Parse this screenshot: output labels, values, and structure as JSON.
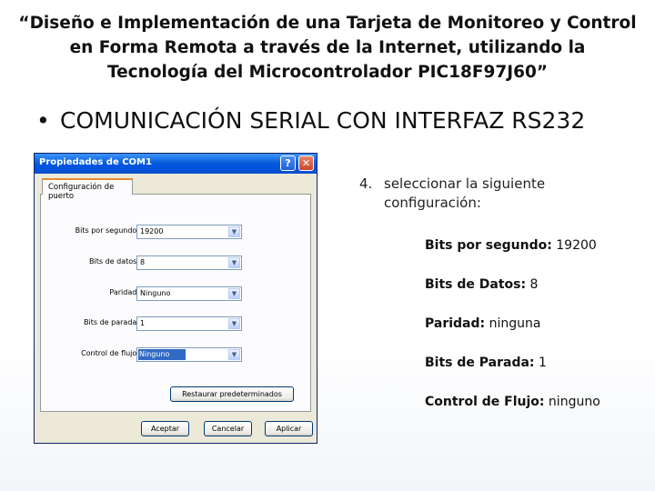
{
  "slide": {
    "title": "“Diseño e Implementación de una Tarjeta de Monitoreo y Control en Forma Remota a través de la Internet, utilizando la Tecnología del Microcontrolador PIC18F97J60”",
    "bullet": "COMUNICACIÓN SERIAL CON INTERFAZ RS232",
    "bullet_marker": "•"
  },
  "dialog": {
    "title": "Propiedades de COM1",
    "help_glyph": "?",
    "close_glyph": "✕",
    "tab": "Configuración de puerto",
    "fields": [
      {
        "label": "Bits por segundo:",
        "value": "19200"
      },
      {
        "label": "Bits de datos:",
        "value": "8"
      },
      {
        "label": "Paridad:",
        "value": "Ninguno"
      },
      {
        "label": "Bits de parada:",
        "value": "1"
      },
      {
        "label": "Control de flujo:",
        "value": "Ninguno"
      }
    ],
    "restore_button": "Restaurar predeterminados",
    "ok_button": "Aceptar",
    "cancel_button": "Cancelar",
    "apply_button": "Aplicar",
    "arrow_glyph": "▼"
  },
  "instructions": {
    "step_number": "4.",
    "step_text": "seleccionar la siguiente configuración:",
    "items": [
      {
        "label": "Bits por segundo:",
        "value": " 19200"
      },
      {
        "label": "Bits de Datos:",
        "value": " 8"
      },
      {
        "label": "Paridad:",
        "value": " ninguna"
      },
      {
        "label": "Bits de Parada:",
        "value": " 1"
      },
      {
        "label": "Control de Flujo:",
        "value": " ninguno"
      }
    ]
  }
}
